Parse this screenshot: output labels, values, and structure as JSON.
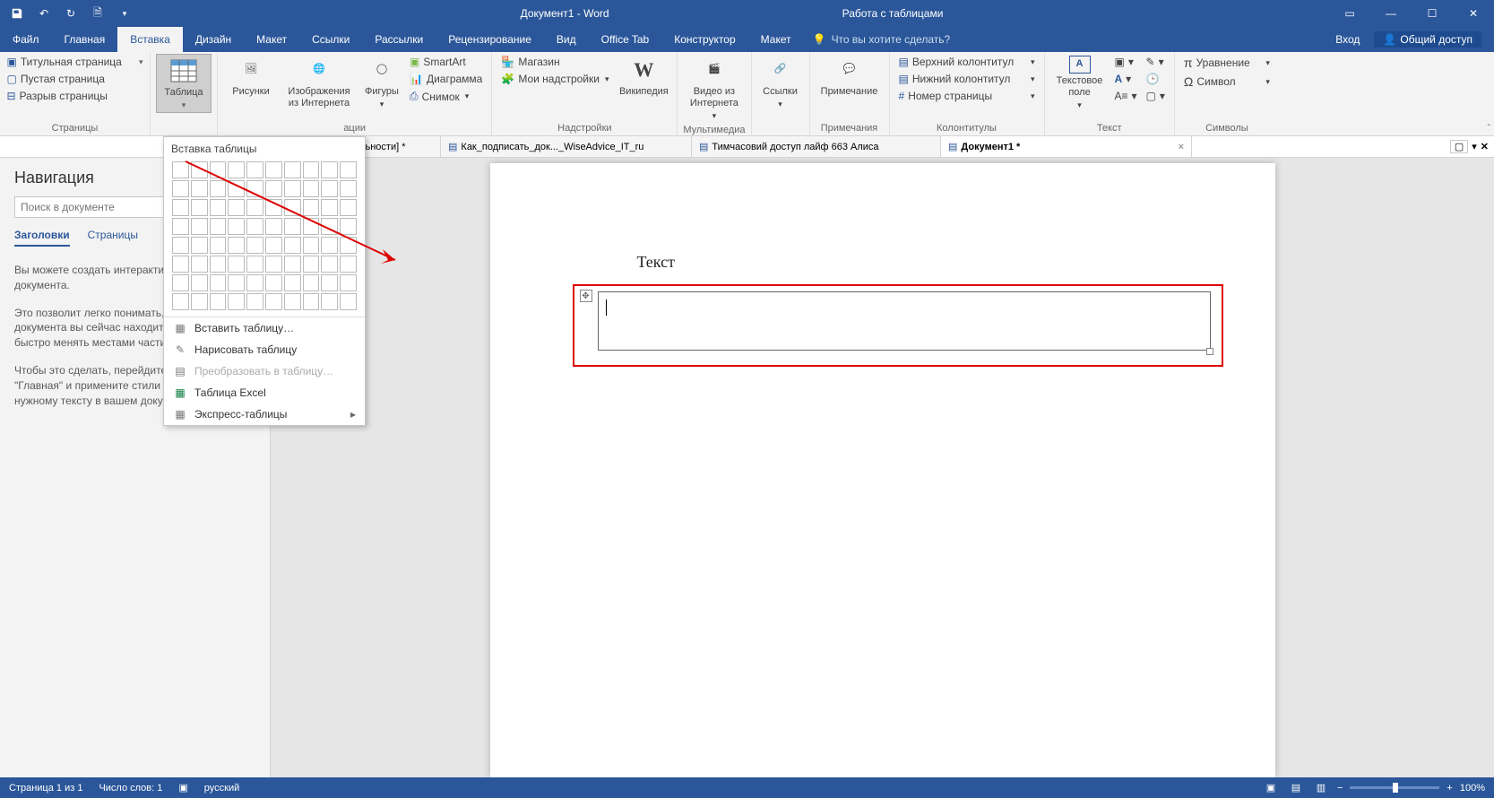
{
  "titlebar": {
    "doc_title": "Документ1 - Word",
    "context_title": "Работа с таблицами"
  },
  "menu": {
    "file": "Файл",
    "home": "Главная",
    "insert": "Вставка",
    "design": "Дизайн",
    "layout": "Макет",
    "references": "Ссылки",
    "mailings": "Рассылки",
    "review": "Рецензирование",
    "view": "Вид",
    "office_tab": "Office Tab",
    "constructor": "Конструктор",
    "layout2": "Макет",
    "tellme_placeholder": "Что вы хотите сделать?",
    "signin": "Вход",
    "share": "Общий доступ"
  },
  "ribbon": {
    "pages": {
      "cover": "Титульная страница",
      "blank": "Пустая страница",
      "break": "Разрыв страницы",
      "group": "Страницы"
    },
    "tables": {
      "btn": "Таблица"
    },
    "illustrations": {
      "pictures": "Рисунки",
      "online": "Изображения из Интернета",
      "shapes": "Фигуры",
      "smartart": "SmartArt",
      "chart": "Диаграмма",
      "screenshot": "Снимок",
      "group": "ации"
    },
    "addins": {
      "store": "Магазин",
      "my": "Мои надстройки",
      "wiki": "Википедия",
      "group": "Надстройки"
    },
    "media": {
      "video": "Видео из Интернета",
      "group": "Мультимедиа"
    },
    "links": {
      "links": "Ссылки",
      "group": ""
    },
    "comments": {
      "comment": "Примечание",
      "group": "Примечания"
    },
    "headerfooter": {
      "header": "Верхний колонтитул",
      "footer": "Нижний колонтитул",
      "pagenum": "Номер страницы",
      "group": "Колонтитулы"
    },
    "text": {
      "textbox": "Текстовое поле",
      "group": "Текст"
    },
    "symbols": {
      "equation": "Уравнение",
      "symbol": "Символ",
      "group": "Символы"
    }
  },
  "doctabs": {
    "t1": "опиту ...кциональности] *",
    "t2": "Как_подписать_док..._WiseAdvice_IT_ru",
    "t3": "Тимчасовий доступ лайф 663 Алиса",
    "t4": "Документ1 *"
  },
  "nav": {
    "title": "Навигация",
    "search_placeholder": "Поиск в документе",
    "tab_headings": "Заголовки",
    "tab_pages": "Страницы",
    "p1": "Вы можете создать интерактивную структуру документа.",
    "p2": "Это позволит легко понимать, в какой части документа вы сейчас находитесь, а также быстро менять местами части.",
    "p3": "Чтобы это сделать, перейдите на вкладку \"Главная\" и примените стили заголовков к нужному тексту в вашем документе."
  },
  "tablemenu": {
    "title": "Вставка таблицы",
    "insert": "Вставить таблицу…",
    "draw": "Нарисовать таблицу",
    "convert": "Преобразовать в таблицу…",
    "excel": "Таблица Excel",
    "quick": "Экспресс-таблицы"
  },
  "page": {
    "text": "Текст"
  },
  "status": {
    "page": "Страница 1 из 1",
    "words": "Число слов: 1",
    "lang": "русский",
    "zoom": "100%"
  }
}
